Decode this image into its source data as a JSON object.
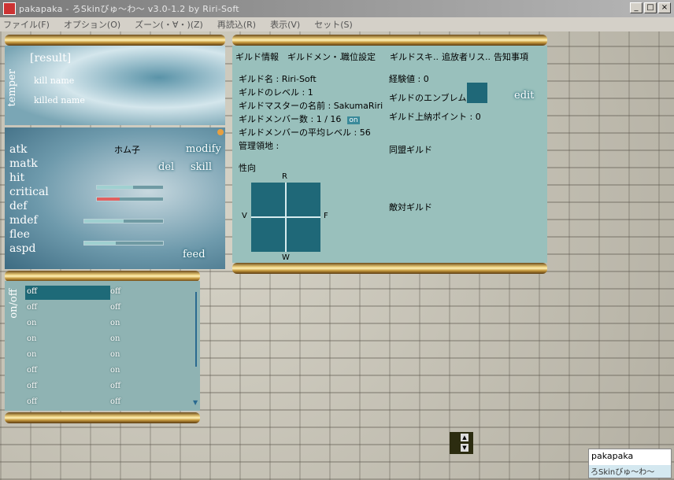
{
  "window": {
    "title": "pakapaka - ろSkinびゅ〜わ〜 v3.0-1.2 by Riri-Soft",
    "min": "_",
    "max": "□",
    "close": "×"
  },
  "menu": [
    "ファイル(F)",
    "オプション(O)",
    "ズーン(・∀・)(Z)",
    "再読込(R)",
    "表示(V)",
    "セット(S)"
  ],
  "result": {
    "vtitle": "temper",
    "title": "[result]",
    "kill_name": "kill name",
    "killed_name": "killed name"
  },
  "status": {
    "labels": [
      "atk",
      "matk",
      "hit",
      "critical",
      "def",
      "mdef",
      "flee",
      "aspd"
    ],
    "char_name": "ホム子",
    "modify": "modify",
    "del": "del",
    "skill": "skill",
    "feed": "feed",
    "bars": [
      {
        "fill": 0.55,
        "color": "#9fd0d0"
      },
      {
        "fill": 0.35,
        "color": "#e06060"
      },
      {
        "fill": 0.5,
        "color": "#9fd0d0"
      },
      {
        "fill": 0.4,
        "color": "#9fd0d0"
      }
    ]
  },
  "onoff": {
    "vtitle": "on/off",
    "rows": [
      [
        "off",
        "off"
      ],
      [
        "off",
        "off"
      ],
      [
        "on",
        "on"
      ],
      [
        "on",
        "on"
      ],
      [
        "on",
        "on"
      ],
      [
        "off",
        "on"
      ],
      [
        "off",
        "off"
      ],
      [
        "off",
        "off"
      ]
    ]
  },
  "guild": {
    "tabs": [
      "ギルド情報",
      "ギルドメン・.",
      "職位設定",
      "ギルドスキ..",
      "追放者リス..",
      "告知事項"
    ],
    "name": "ギルド名 : Riri-Soft",
    "level": "ギルドのレベル : 1",
    "master": "ギルドマスターの名前 : SakumaRiri",
    "members": "ギルドメンバー数 : 1 / 16",
    "members_badge": "on",
    "avg_level": "ギルドメンバーの平均レベル : 56",
    "territory": "管理領地 :",
    "exp": "経験値 : 0",
    "emblem": "ギルドのエンブレム",
    "edit": "edit",
    "tax": "ギルド上納ポイント : 0",
    "ally": "同盟ギルド",
    "enemy": "敵対ギルド",
    "tendency": "性向",
    "axes": {
      "top": "R",
      "bottom": "W",
      "left": "V",
      "right": "F"
    }
  },
  "mini_scroll": {
    "up": "▲",
    "down": "▼"
  },
  "name_box": {
    "line1": "pakapaka",
    "line2": "ろSkinびゅ〜わ〜"
  }
}
